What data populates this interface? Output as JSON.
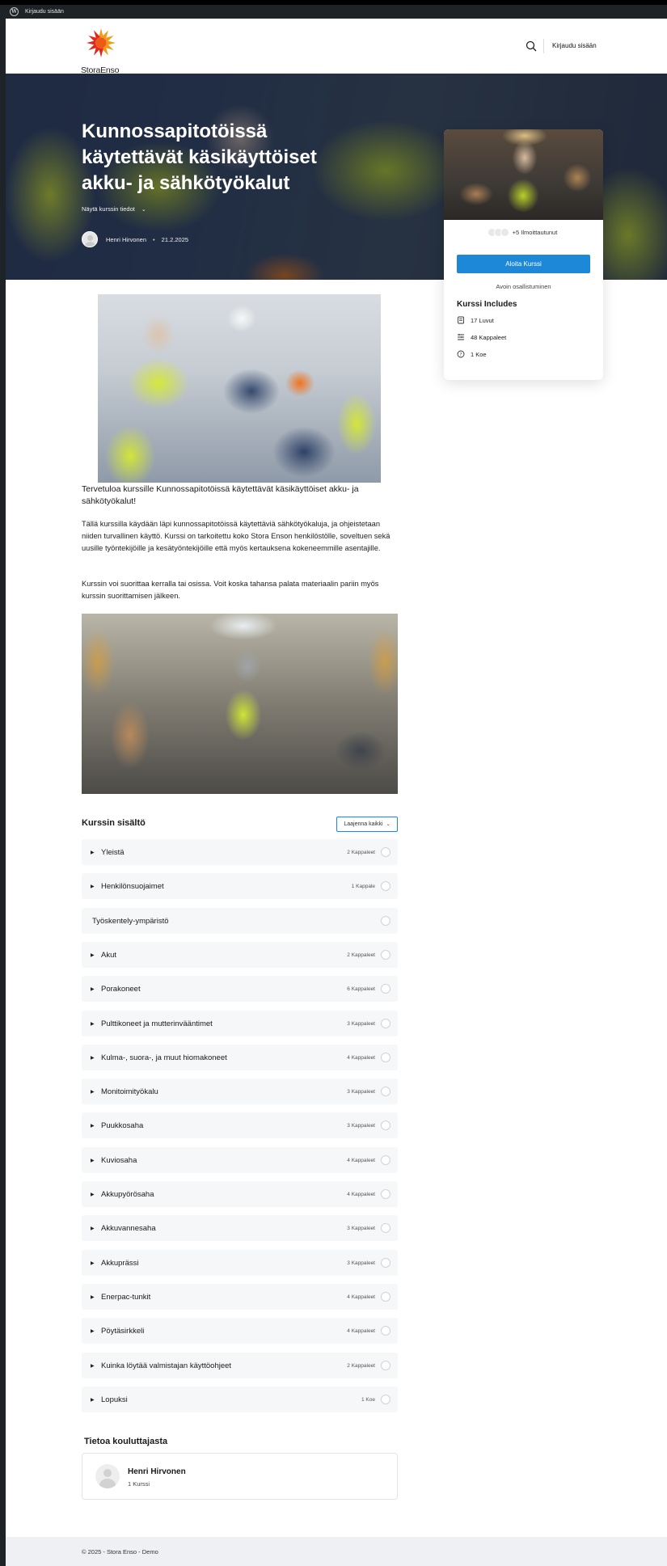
{
  "adminbar": {
    "login_label": "Kirjaudu sisään"
  },
  "header": {
    "logo_text": "StoraEnso",
    "login_label": "Kirjaudu sisään"
  },
  "hero": {
    "title": "Kunnossapitotöissä käytettävät käsikäyttöiset akku- ja sähkötyökalut",
    "details_label": "Näytä kurssin tiedot",
    "author": "Henri Hirvonen",
    "date": "21.2.2025"
  },
  "sidecard": {
    "enrolled": "+5 Ilmoittautunut",
    "start_button": "Aloita Kurssi",
    "open_enroll": "Avoin osallistuminen",
    "includes_title": "Kurssi Includes",
    "includes": [
      {
        "icon": "book-icon",
        "label": "17 Luvut"
      },
      {
        "icon": "list-icon",
        "label": "48 Kappaleet"
      },
      {
        "icon": "quiz-icon",
        "label": "1 Koe"
      }
    ]
  },
  "intro": "Tervetuloa kurssille Kunnossapitotöissä käytettävät käsikäyttöiset akku- ja sähkötyökalut!",
  "paragraphs": [
    "Tällä kurssilla käydään läpi kunnossapitotöissä käytettäviä sähkötyökaluja, ja ohjeistetaan niiden turvallinen käyttö. Kurssi on tarkoitettu koko Stora Enson henkilöstölle, soveltuen sekä uusille työntekijöille ja kesätyöntekijöille että myös kertauksena kokeneemmille asentajille.",
    "Kurssin voi suorittaa kerralla tai osissa. Voit koska tahansa palata materiaalin pariin myös kurssin suorittamisen jälkeen."
  ],
  "content": {
    "title": "Kurssin sisältö",
    "expand_label": "Laajenna kaikki",
    "sections": [
      {
        "name": "Yleistä",
        "count": "2 Kappaleet",
        "arrow": true
      },
      {
        "name": "Henkilönsuojaimet",
        "count": "1 Kappale",
        "arrow": true
      },
      {
        "name": "Työskentely-ympäristö",
        "count": "",
        "arrow": false
      },
      {
        "name": "Akut",
        "count": "2 Kappaleet",
        "arrow": true
      },
      {
        "name": "Porakoneet",
        "count": "6 Kappaleet",
        "arrow": true
      },
      {
        "name": "Pulttikoneet ja mutterinvääntimet",
        "count": "3 Kappaleet",
        "arrow": true
      },
      {
        "name": "Kulma-, suora-, ja muut hiomakoneet",
        "count": "4 Kappaleet",
        "arrow": true
      },
      {
        "name": "Monitoimityökalu",
        "count": "3 Kappaleet",
        "arrow": true
      },
      {
        "name": "Puukkosaha",
        "count": "3 Kappaleet",
        "arrow": true
      },
      {
        "name": "Kuviosaha",
        "count": "4 Kappaleet",
        "arrow": true
      },
      {
        "name": "Akkupyörösaha",
        "count": "4 Kappaleet",
        "arrow": true
      },
      {
        "name": "Akkuvannesaha",
        "count": "3 Kappaleet",
        "arrow": true
      },
      {
        "name": "Akkuprässi",
        "count": "3 Kappaleet",
        "arrow": true
      },
      {
        "name": "Enerpac-tunkit",
        "count": "4 Kappaleet",
        "arrow": true
      },
      {
        "name": "Pöytäsirkkeli",
        "count": "4 Kappaleet",
        "arrow": true
      },
      {
        "name": "Kuinka löytää valmistajan käyttöohjeet",
        "count": "2 Kappaleet",
        "arrow": true
      },
      {
        "name": "Lopuksi",
        "count": "1 Koe",
        "arrow": true
      }
    ]
  },
  "instructor": {
    "title": "Tietoa kouluttajasta",
    "name": "Henri Hirvonen",
    "courses": "1 Kurssi"
  },
  "footer": {
    "text": "© 2025 - Stora Enso - Demo"
  },
  "colors": {
    "accent": "#1e88d8",
    "adminbar": "#1d2327",
    "row_bg": "#f6f7f9",
    "footer_bg": "#eef0f3"
  }
}
